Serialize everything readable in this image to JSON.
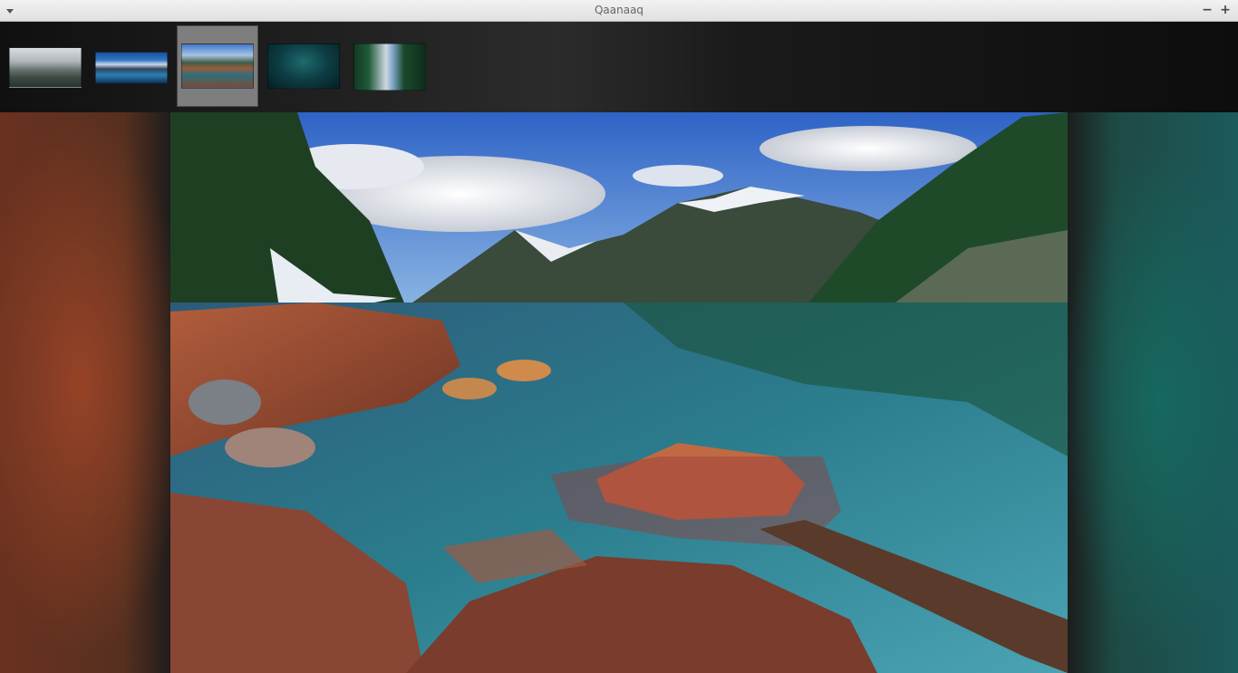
{
  "window": {
    "title": "Qaanaaq",
    "menu_icon": "chevron-down-icon",
    "controls": {
      "minimize": "−",
      "maximize": "+",
      "close": "×"
    }
  },
  "thumbnails": [
    {
      "name": "misty-mountain-forest",
      "selected": false
    },
    {
      "name": "mountain-lake-panorama",
      "selected": false
    },
    {
      "name": "rocky-lake-shore",
      "selected": true
    },
    {
      "name": "dark-teal-forest",
      "selected": false
    },
    {
      "name": "pine-trees-snow-peak",
      "selected": false
    }
  ],
  "main_image": {
    "description_name": "lake-with-rocks-and-mountains"
  },
  "colors": {
    "titlebar": "#e8e8e8",
    "selected_thumb": "#7e7e7e",
    "title_text": "#666666"
  }
}
